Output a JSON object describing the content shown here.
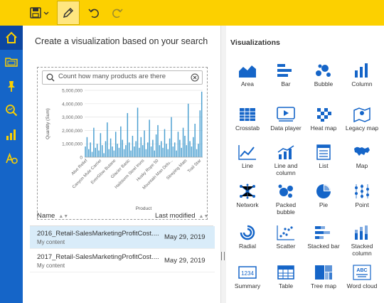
{
  "toolbar": {
    "icons": [
      "save-icon",
      "dropdown-caret-icon",
      "pencil-icon",
      "undo-icon",
      "redo-icon"
    ],
    "accent_color": "#fcd000"
  },
  "leftnav": {
    "items": [
      "home-icon",
      "data-module-icon",
      "pin-icon",
      "search-explore-icon",
      "visualizations-icon",
      "text-icon"
    ],
    "color": "#1565c8"
  },
  "panel": {
    "title": "Create a visualization based on your search",
    "search_text": "Count how many products are there"
  },
  "chart_data": {
    "type": "bar",
    "xlabel": "Product",
    "ylabel": "Quantity (Sum)",
    "yticks": [
      "5,000,000",
      "4,000,000",
      "3,000,000",
      "2,000,000",
      "1,000,000",
      "0"
    ],
    "ylim": [
      0,
      5000000
    ],
    "xtick_labels": [
      "Aloe Relief",
      "Canyon Mule Carrier",
      "EverGlow Butane",
      "Glacier Basic",
      "Hailstorm Steel Irons",
      "Husky Rope 50",
      "Mountain Man Delu...",
      "Sleeping Mats",
      "Trail Star"
    ],
    "values": [
      800000,
      1500000,
      600000,
      1100000,
      400000,
      2200000,
      700000,
      1000000,
      500000,
      1800000,
      900000,
      300000,
      1200000,
      2600000,
      600000,
      1400000,
      800000,
      500000,
      1900000,
      1000000,
      700000,
      2300000,
      1300000,
      600000,
      900000,
      3300000,
      1100000,
      500000,
      1600000,
      800000,
      1200000,
      3700000,
      700000,
      1500000,
      900000,
      2000000,
      600000,
      1100000,
      2800000,
      800000,
      1300000,
      500000,
      1700000,
      2400000,
      900000,
      1200000,
      700000,
      2100000,
      1000000,
      600000,
      1400000,
      3000000,
      800000,
      1100000,
      500000,
      1900000,
      1300000,
      700000,
      2200000,
      1600000,
      900000,
      4000000,
      1200000,
      800000,
      1500000,
      2500000,
      600000,
      1000000,
      3500000,
      4900000
    ],
    "bar_color": "#4a9fd0",
    "grid": true
  },
  "list": {
    "header_name": "Name",
    "header_modified": "Last modified",
    "rows": [
      {
        "title": "2016_Retail-SalesMarketingProfitCost....",
        "sub": "My content",
        "date": "May 29, 2019"
      },
      {
        "title": "2017_Retail-SalesMarketingProfitCost....",
        "sub": "My content",
        "date": "May 29, 2019"
      }
    ]
  },
  "viz": {
    "title": "Visualizations",
    "items": [
      {
        "label": "Area",
        "icon": "area-chart-icon"
      },
      {
        "label": "Bar",
        "icon": "bar-chart-icon"
      },
      {
        "label": "Bubble",
        "icon": "bubble-chart-icon"
      },
      {
        "label": "Column",
        "icon": "column-chart-icon"
      },
      {
        "label": "Crosstab",
        "icon": "crosstab-icon"
      },
      {
        "label": "Data player",
        "icon": "data-player-icon"
      },
      {
        "label": "Heat map",
        "icon": "heat-map-icon"
      },
      {
        "label": "Legacy map",
        "icon": "legacy-map-icon"
      },
      {
        "label": "Line",
        "icon": "line-chart-icon"
      },
      {
        "label": "Line and column",
        "icon": "line-and-column-icon"
      },
      {
        "label": "List",
        "icon": "list-icon"
      },
      {
        "label": "Map",
        "icon": "map-icon"
      },
      {
        "label": "Network",
        "icon": "network-icon"
      },
      {
        "label": "Packed bubble",
        "icon": "packed-bubble-icon"
      },
      {
        "label": "Pie",
        "icon": "pie-chart-icon"
      },
      {
        "label": "Point",
        "icon": "point-chart-icon"
      },
      {
        "label": "Radial",
        "icon": "radial-chart-icon"
      },
      {
        "label": "Scatter",
        "icon": "scatter-chart-icon"
      },
      {
        "label": "Stacked bar",
        "icon": "stacked-bar-icon"
      },
      {
        "label": "Stacked column",
        "icon": "stacked-column-icon"
      },
      {
        "label": "Summary",
        "icon": "summary-icon"
      },
      {
        "label": "Table",
        "icon": "table-icon"
      },
      {
        "label": "Tree map",
        "icon": "tree-map-icon"
      },
      {
        "label": "Word cloud",
        "icon": "word-cloud-icon"
      }
    ],
    "icon_color": "#1565c8"
  }
}
